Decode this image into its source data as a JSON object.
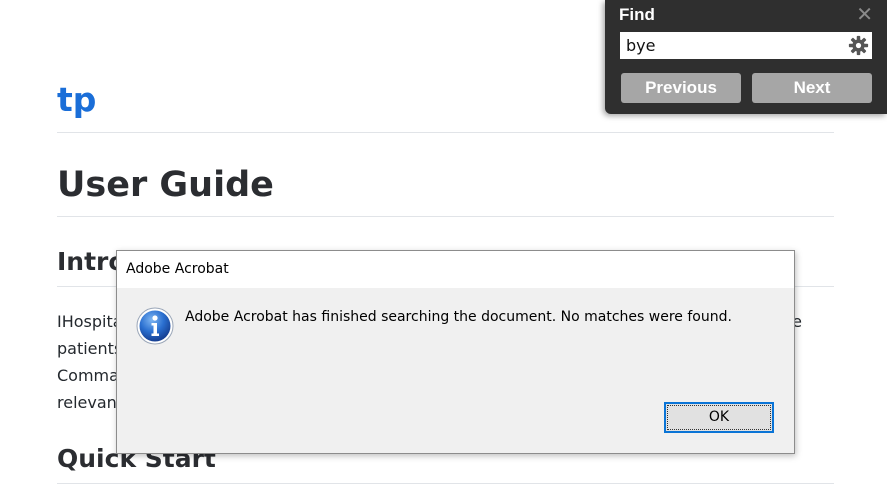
{
  "document": {
    "site_title": "tp",
    "heading": "User Guide",
    "section_intro": "Introduction",
    "intro_lines": [
      "IHospital",
      "patients",
      "Comma",
      "relevan"
    ],
    "intro_trailing": "e",
    "section_quickstart": "Quick Start"
  },
  "find_panel": {
    "title": "Find",
    "search_value": "bye",
    "previous_label": "Previous",
    "next_label": "Next",
    "close_icon": "close-icon",
    "settings_icon": "gear-icon"
  },
  "dialog": {
    "title": "Adobe Acrobat",
    "message": "Adobe Acrobat has finished searching the document. No matches were found.",
    "ok_label": "OK",
    "icon": "info-icon",
    "accent": "#0a74d6"
  }
}
